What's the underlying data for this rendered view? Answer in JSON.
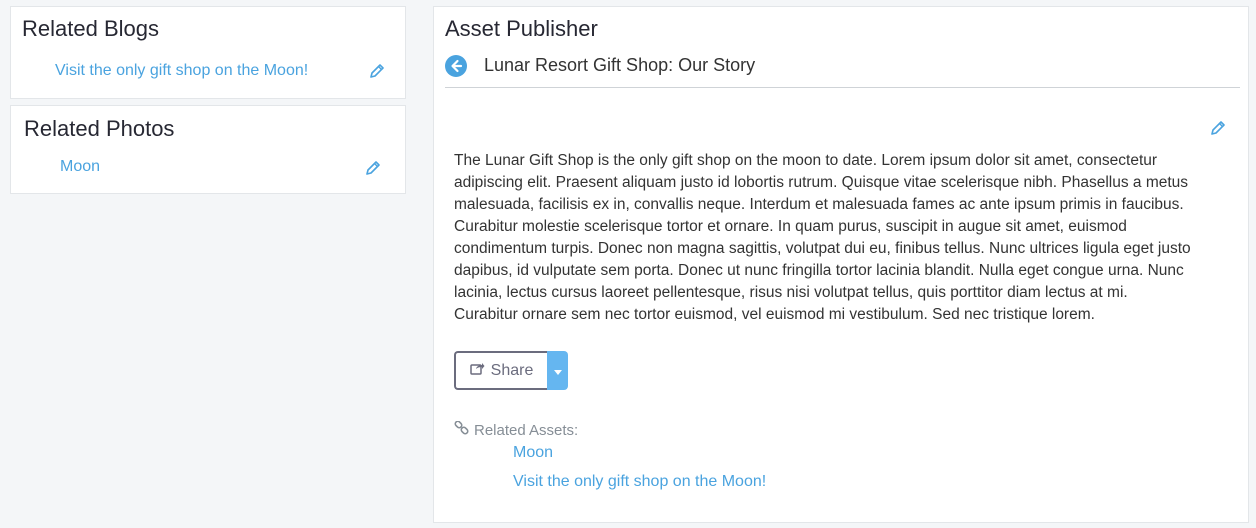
{
  "related_blogs": {
    "title": "Related Blogs",
    "items": [
      {
        "label": "Visit the only gift shop on the Moon!"
      }
    ]
  },
  "related_photos": {
    "title": "Related Photos",
    "items": [
      {
        "label": "Moon"
      }
    ]
  },
  "asset_publisher": {
    "title": "Asset Publisher",
    "asset_title": "Lunar Resort Gift Shop: Our Story",
    "body_lines": [
      "The Lunar Gift Shop is the only gift shop on the moon to date. Lorem ipsum dolor sit amet, consectetur",
      "adipiscing elit. Praesent aliquam justo id lobortis rutrum. Quisque vitae scelerisque nibh. Phasellus a metus",
      "malesuada, facilisis ex in, convallis neque. Interdum et malesuada fames ac ante ipsum primis in faucibus.",
      "Curabitur molestie scelerisque tortor et ornare. In quam purus, suscipit in augue sit amet, euismod",
      "condimentum turpis. Donec non magna sagittis, volutpat dui eu, finibus tellus. Nunc ultrices ligula eget justo",
      "dapibus, id vulputate sem porta. Donec ut nunc fringilla tortor lacinia blandit. Nulla eget congue urna. Nunc",
      "lacinia, lectus cursus laoreet pellentesque, risus nisi volutpat tellus, quis porttitor diam lectus at mi.",
      "Curabitur ornare sem nec tortor euismod, vel euismod mi vestibulum. Sed nec tristique lorem."
    ],
    "share_label": "Share",
    "related_assets_label": "Related Assets:",
    "related_assets": [
      {
        "label": "Moon"
      },
      {
        "label": "Visit the only gift shop on the Moon!"
      }
    ]
  },
  "colors": {
    "link": "#4aa3df",
    "accent": "#65b6f0",
    "page_bg": "#f4f6f8"
  },
  "icons": {
    "edit": "pencil-icon",
    "back": "arrow-left-circle-icon",
    "share": "share-icon",
    "caret": "caret-down-icon",
    "related": "link-icon"
  }
}
